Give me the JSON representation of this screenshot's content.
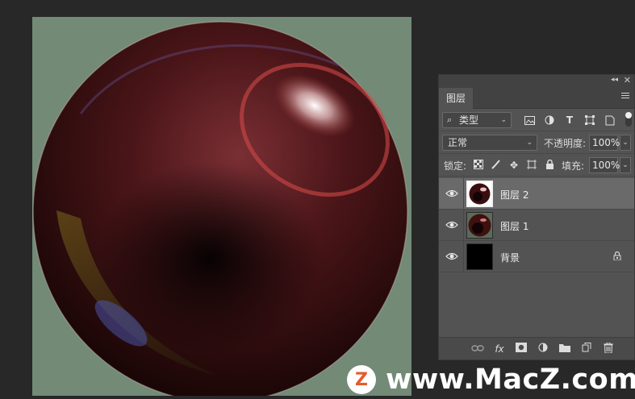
{
  "panel": {
    "tab_label": "图层",
    "filter_kind": "类型",
    "blend_mode": "正常",
    "opacity_label": "不透明度:",
    "opacity_value": "100%",
    "lock_label": "锁定:",
    "fill_label": "填充:",
    "fill_value": "100%"
  },
  "layers": [
    {
      "name": "图层 2",
      "selected": true,
      "visible": true,
      "locked": false
    },
    {
      "name": "图层 1",
      "selected": false,
      "visible": true,
      "locked": false
    },
    {
      "name": "背景",
      "selected": false,
      "visible": true,
      "locked": true
    }
  ],
  "watermark": {
    "logo_letter": "Z",
    "text": "www.MacZ.com"
  },
  "colors": {
    "canvas_bg": "#728a76",
    "app_bg": "#282828",
    "panel_bg": "#535353",
    "selected_row": "#6a6a6a"
  },
  "icons": {
    "filter": [
      "image-filter-icon",
      "adjustment-filter-icon",
      "type-filter-icon",
      "shape-filter-icon",
      "smart-object-filter-icon"
    ],
    "lock": [
      "lock-transparent-icon",
      "lock-image-icon",
      "lock-position-icon",
      "lock-artboard-icon",
      "lock-all-icon"
    ],
    "bottom": [
      "link-layers-icon",
      "fx-icon",
      "add-mask-icon",
      "adjustment-layer-icon",
      "new-group-icon",
      "new-layer-icon",
      "delete-layer-icon"
    ]
  }
}
